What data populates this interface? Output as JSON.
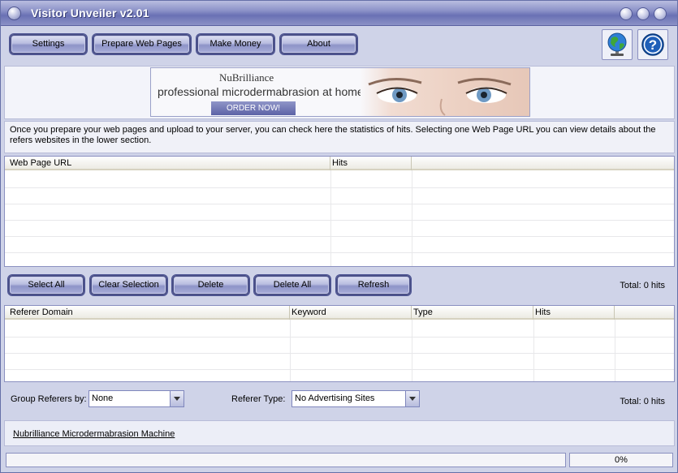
{
  "window": {
    "title": "Visitor Unveiler v2.01"
  },
  "toolbar": {
    "settings_label": "Settings",
    "prepare_label": "Prepare Web Pages",
    "money_label": "Make Money",
    "about_label": "About",
    "web_icon": "globe-icon",
    "help_icon": "question-icon"
  },
  "banner": {
    "brand": "NuBrilliance",
    "tagline": "professional microdermabrasion at home!",
    "cta": "ORDER NOW!"
  },
  "info": {
    "text": "Once you prepare your web pages and upload to your server, you can check here the statistics of hits. Selecting one Web Page URL you can view details about the refers websites in the lower section."
  },
  "pages_table": {
    "columns": [
      "Web Page URL",
      "Hits",
      ""
    ]
  },
  "pages_actions": {
    "select_all": "Select All",
    "clear_selection": "Clear Selection",
    "delete": "Delete",
    "delete_all": "Delete All",
    "refresh": "Refresh",
    "total": "Total: 0 hits"
  },
  "referers_table": {
    "columns": [
      "Referer Domain",
      "Keyword",
      "Type",
      "Hits",
      ""
    ]
  },
  "filters": {
    "group_label": "Group Referers by:",
    "group_value": "None",
    "type_label": "Referer Type:",
    "type_value": "No Advertising Sites",
    "total": "Total: 0 hits"
  },
  "link": {
    "text": "Nubrilliance Microdermabrasion Machine"
  },
  "status": {
    "progress_text": "0%",
    "progress": 0
  },
  "colors": {
    "accent": "#6a71b4",
    "panel": "#cfd3e8"
  }
}
